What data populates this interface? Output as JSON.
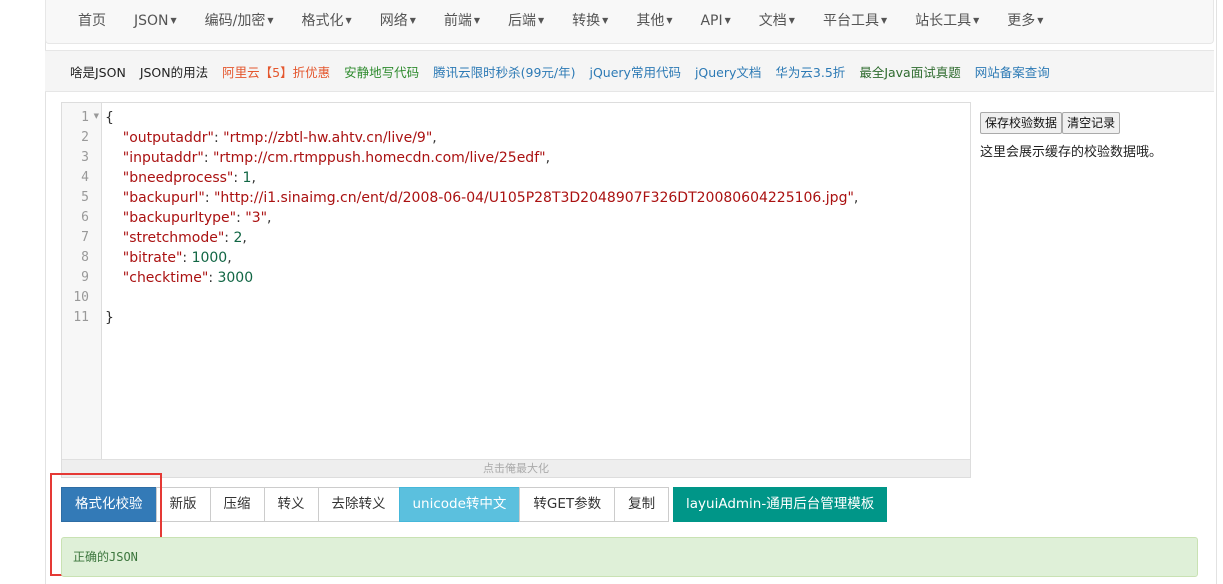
{
  "nav": {
    "items": [
      {
        "label": "首页",
        "dropdown": false
      },
      {
        "label": "JSON",
        "dropdown": true
      },
      {
        "label": "编码/加密",
        "dropdown": true
      },
      {
        "label": "格式化",
        "dropdown": true
      },
      {
        "label": "网络",
        "dropdown": true
      },
      {
        "label": "前端",
        "dropdown": true
      },
      {
        "label": "后端",
        "dropdown": true
      },
      {
        "label": "转换",
        "dropdown": true
      },
      {
        "label": "其他",
        "dropdown": true
      },
      {
        "label": "API",
        "dropdown": true
      },
      {
        "label": "文档",
        "dropdown": true
      },
      {
        "label": "平台工具",
        "dropdown": true
      },
      {
        "label": "站长工具",
        "dropdown": true
      },
      {
        "label": "更多",
        "dropdown": true
      }
    ]
  },
  "links": [
    {
      "label": "啥是JSON",
      "color": "#222222"
    },
    {
      "label": "JSON的用法",
      "color": "#222222"
    },
    {
      "label": "阿里云【5】折优惠",
      "color": "#e4572e"
    },
    {
      "label": "安静地写代码",
      "color": "#2e8b2e"
    },
    {
      "label": "腾讯云限时秒杀(99元/年)",
      "color": "#2d7ab5"
    },
    {
      "label": "jQuery常用代码",
      "color": "#2d7ab5"
    },
    {
      "label": "jQuery文档",
      "color": "#2d7ab5"
    },
    {
      "label": "华为云3.5折",
      "color": "#2d7ab5"
    },
    {
      "label": "最全Java面试真题",
      "color": "#2e6b2e"
    },
    {
      "label": "网站备案查询",
      "color": "#2d7ab5"
    }
  ],
  "editor": {
    "line_numbers": [
      "1",
      "2",
      "3",
      "4",
      "5",
      "6",
      "7",
      "8",
      "9",
      "10",
      "11"
    ],
    "lines": [
      {
        "parts": [
          {
            "t": "{",
            "c": "p"
          }
        ]
      },
      {
        "parts": [
          {
            "t": "    \"outputaddr\"",
            "c": "k"
          },
          {
            "t": ": ",
            "c": "p"
          },
          {
            "t": "\"rtmp://zbtl-hw.ahtv.cn/live/9\"",
            "c": "s"
          },
          {
            "t": ",",
            "c": "p"
          }
        ]
      },
      {
        "parts": [
          {
            "t": "    \"inputaddr\"",
            "c": "k"
          },
          {
            "t": ": ",
            "c": "p"
          },
          {
            "t": "\"rtmp://cm.rtmppush.homecdn.com/live/25edf\"",
            "c": "s"
          },
          {
            "t": ",",
            "c": "p"
          }
        ]
      },
      {
        "parts": [
          {
            "t": "    \"bneedprocess\"",
            "c": "k"
          },
          {
            "t": ": ",
            "c": "p"
          },
          {
            "t": "1",
            "c": "n"
          },
          {
            "t": ",",
            "c": "p"
          }
        ]
      },
      {
        "parts": [
          {
            "t": "    \"backupurl\"",
            "c": "k"
          },
          {
            "t": ": ",
            "c": "p"
          },
          {
            "t": "\"http://i1.sinaimg.cn/ent/d/2008-06-04/U105P28T3D2048907F326DT20080604225106.jpg\"",
            "c": "s"
          },
          {
            "t": ",",
            "c": "p"
          }
        ]
      },
      {
        "parts": [
          {
            "t": "    \"backupurltype\"",
            "c": "k"
          },
          {
            "t": ": ",
            "c": "p"
          },
          {
            "t": "\"3\"",
            "c": "s"
          },
          {
            "t": ",",
            "c": "p"
          }
        ]
      },
      {
        "parts": [
          {
            "t": "    \"stretchmode\"",
            "c": "k"
          },
          {
            "t": ": ",
            "c": "p"
          },
          {
            "t": "2",
            "c": "n"
          },
          {
            "t": ",",
            "c": "p"
          }
        ]
      },
      {
        "parts": [
          {
            "t": "    \"bitrate\"",
            "c": "k"
          },
          {
            "t": ": ",
            "c": "p"
          },
          {
            "t": "1000",
            "c": "n"
          },
          {
            "t": ",",
            "c": "p"
          }
        ]
      },
      {
        "parts": [
          {
            "t": "    \"checktime\"",
            "c": "k"
          },
          {
            "t": ": ",
            "c": "p"
          },
          {
            "t": "3000",
            "c": "n"
          }
        ]
      },
      {
        "parts": [
          {
            "t": "",
            "c": "p"
          }
        ]
      },
      {
        "parts": [
          {
            "t": "}",
            "c": "p"
          }
        ]
      }
    ],
    "resize_hint": "点击俺最大化"
  },
  "side": {
    "save_label": "保存校验数据",
    "clear_label": "清空记录",
    "note": "这里会展示缓存的校验数据哦。"
  },
  "buttons": {
    "format": "格式化校验",
    "new": "新版",
    "compress": "压缩",
    "escape": "转义",
    "unescape": "去除转义",
    "unicode": "unicode转中文",
    "to_get": "转GET参数",
    "copy": "复制",
    "template": "layuiAdmin-通用后台管理模板"
  },
  "result": {
    "message": "正确的JSON"
  }
}
